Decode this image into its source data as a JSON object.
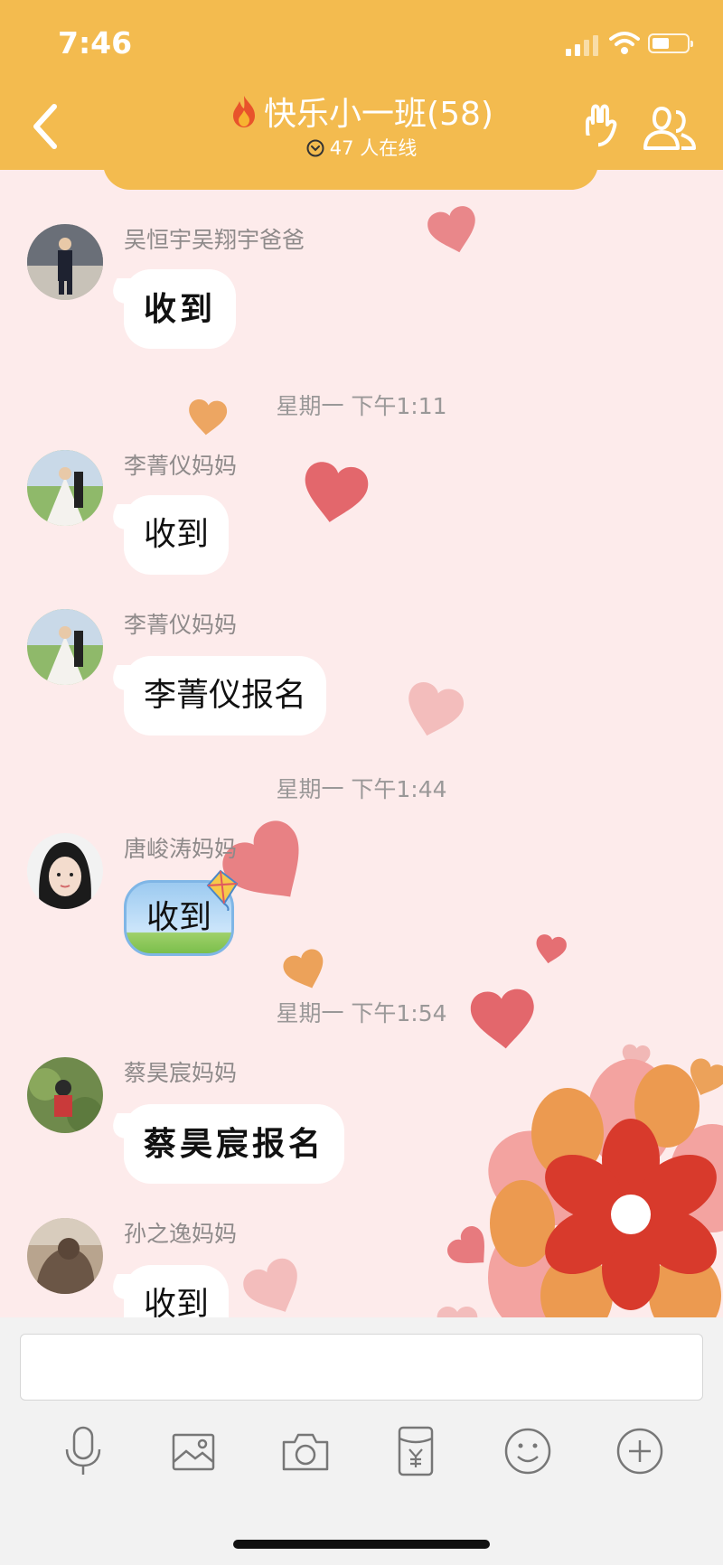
{
  "status_bar": {
    "time": "7:46"
  },
  "header": {
    "title": "快乐小一班(58)",
    "online": "47 人在线"
  },
  "messages": [
    {
      "sender": "吴恒宇吴翔宇爸爸",
      "text": "收到",
      "style": "handwriting"
    },
    {
      "time": "星期一 下午1:11"
    },
    {
      "sender": "李菁仪妈妈",
      "text": "收到",
      "style": "normal"
    },
    {
      "sender": "李菁仪妈妈",
      "text": "李菁仪报名",
      "style": "normal"
    },
    {
      "time": "星期一 下午1:44"
    },
    {
      "sender": "唐峻涛妈妈",
      "text": "收到",
      "style": "kite-theme"
    },
    {
      "time": "星期一 下午1:54"
    },
    {
      "sender": "蔡昊宸妈妈",
      "text": "蔡昊宸报名",
      "style": "handwriting"
    },
    {
      "sender": "孙之逸妈妈",
      "text": "收到",
      "style": "normal"
    }
  ],
  "input": {
    "value": "",
    "placeholder": ""
  },
  "toolbar": [
    "microphone-icon",
    "image-icon",
    "camera-icon",
    "red-packet-icon",
    "emoji-icon",
    "plus-icon"
  ],
  "colors": {
    "header": "#f3bb4f",
    "chat_bg": "#fdebeb",
    "heart": "#e0656a"
  }
}
